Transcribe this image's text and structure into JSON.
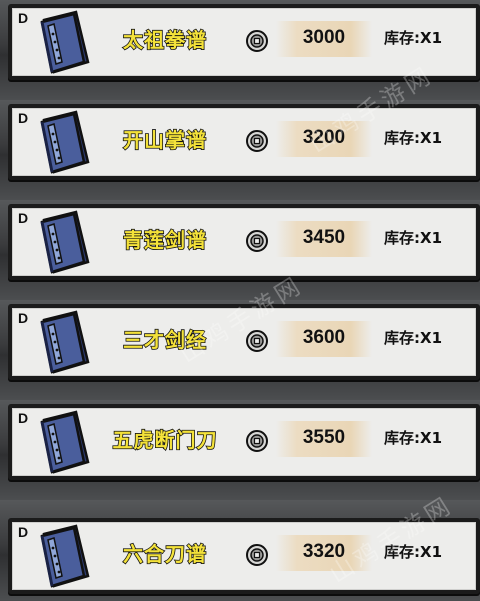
{
  "items": [
    {
      "grade": "D",
      "name": "太祖拳谱",
      "price": "3000",
      "stock": "库存:X1"
    },
    {
      "grade": "D",
      "name": "开山掌谱",
      "price": "3200",
      "stock": "库存:X1"
    },
    {
      "grade": "D",
      "name": "青莲剑谱",
      "price": "3450",
      "stock": "库存:X1"
    },
    {
      "grade": "D",
      "name": "三才剑经",
      "price": "3600",
      "stock": "库存:X1"
    },
    {
      "grade": "D",
      "name": "五虎断门刀",
      "price": "3550",
      "stock": "库存:X1"
    },
    {
      "grade": "D",
      "name": "六合刀谱",
      "price": "3320",
      "stock": "库存:X1"
    }
  ],
  "icons": {
    "item": "manual-book-icon",
    "currency": "coin-icon"
  },
  "colors": {
    "name_text": "#f4e23a",
    "card_bg": "#ededeb",
    "book_blue": "#4a5e9c"
  },
  "watermark": [
    "山鸡手游网",
    "山鸡手游网",
    "山鸡手游网"
  ]
}
